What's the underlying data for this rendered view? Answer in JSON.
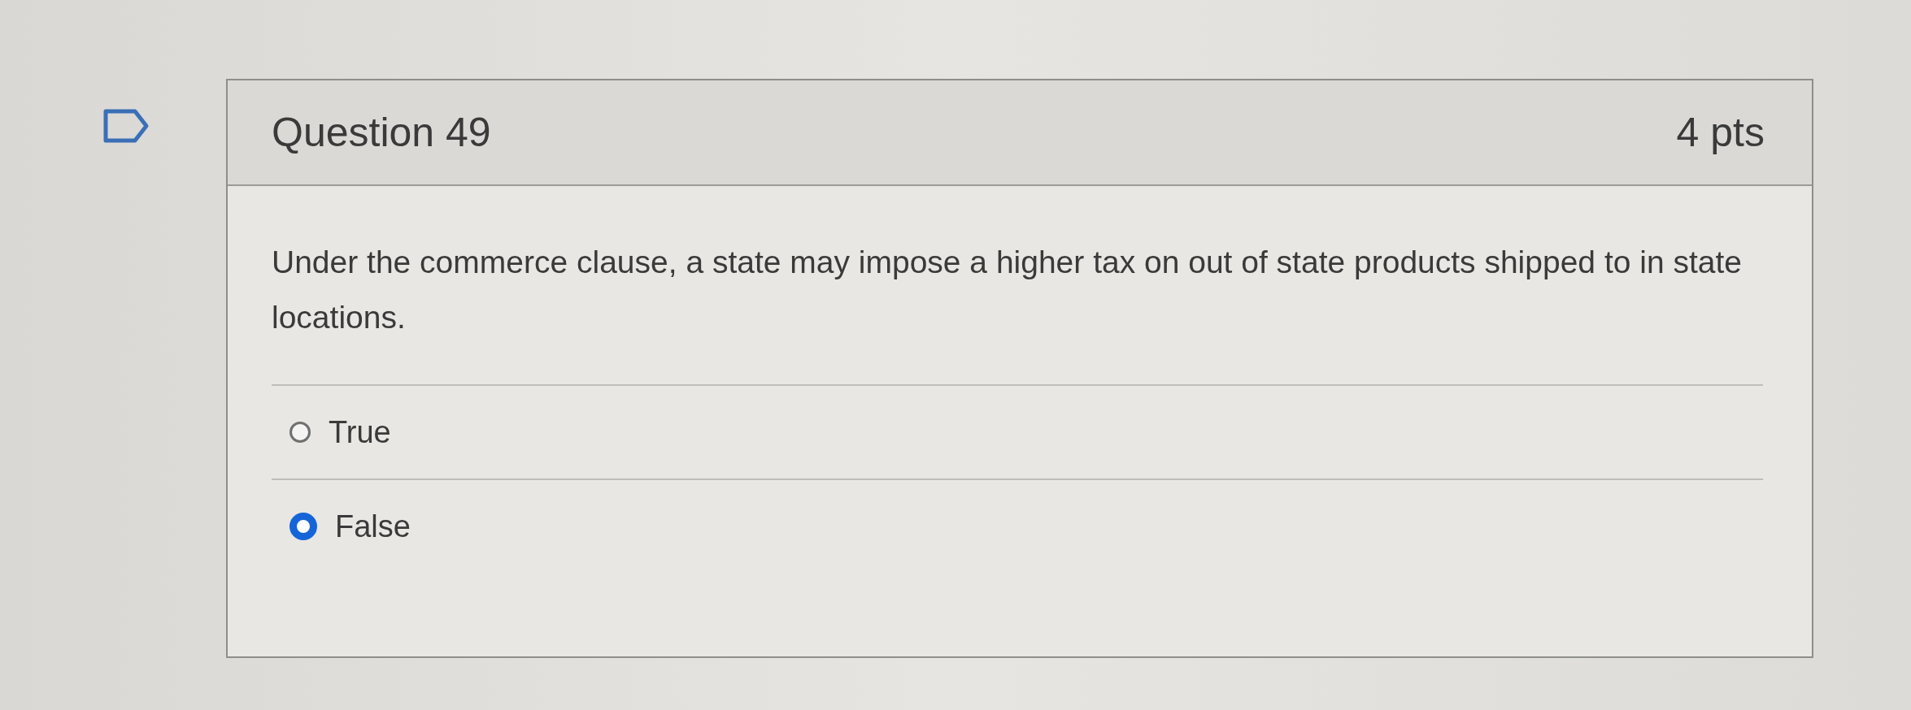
{
  "question": {
    "title": "Question 49",
    "points": "4 pts",
    "text": "Under the commerce clause, a state may impose a higher tax on out of state products shipped to in state locations.",
    "answers": [
      {
        "label": "True",
        "selected": false
      },
      {
        "label": "False",
        "selected": true
      }
    ]
  }
}
